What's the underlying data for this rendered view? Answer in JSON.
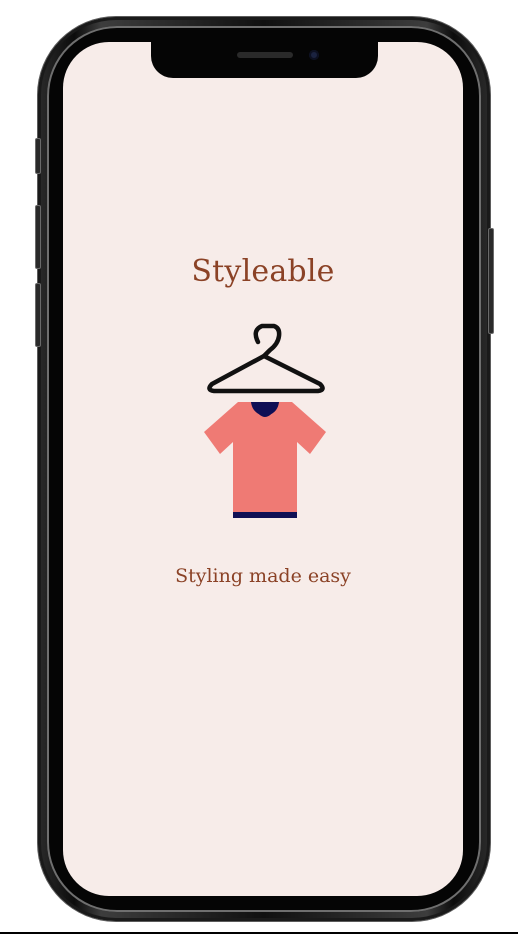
{
  "app": {
    "title": "Styleable",
    "tagline": "Styling made easy",
    "logo_icon": "hanger-shirt-icon"
  },
  "colors": {
    "background": "#f7ece9",
    "text": "#8b4226",
    "shirt": "#ef7a74",
    "shirt_trim": "#0f0f55",
    "hanger": "#111111"
  }
}
